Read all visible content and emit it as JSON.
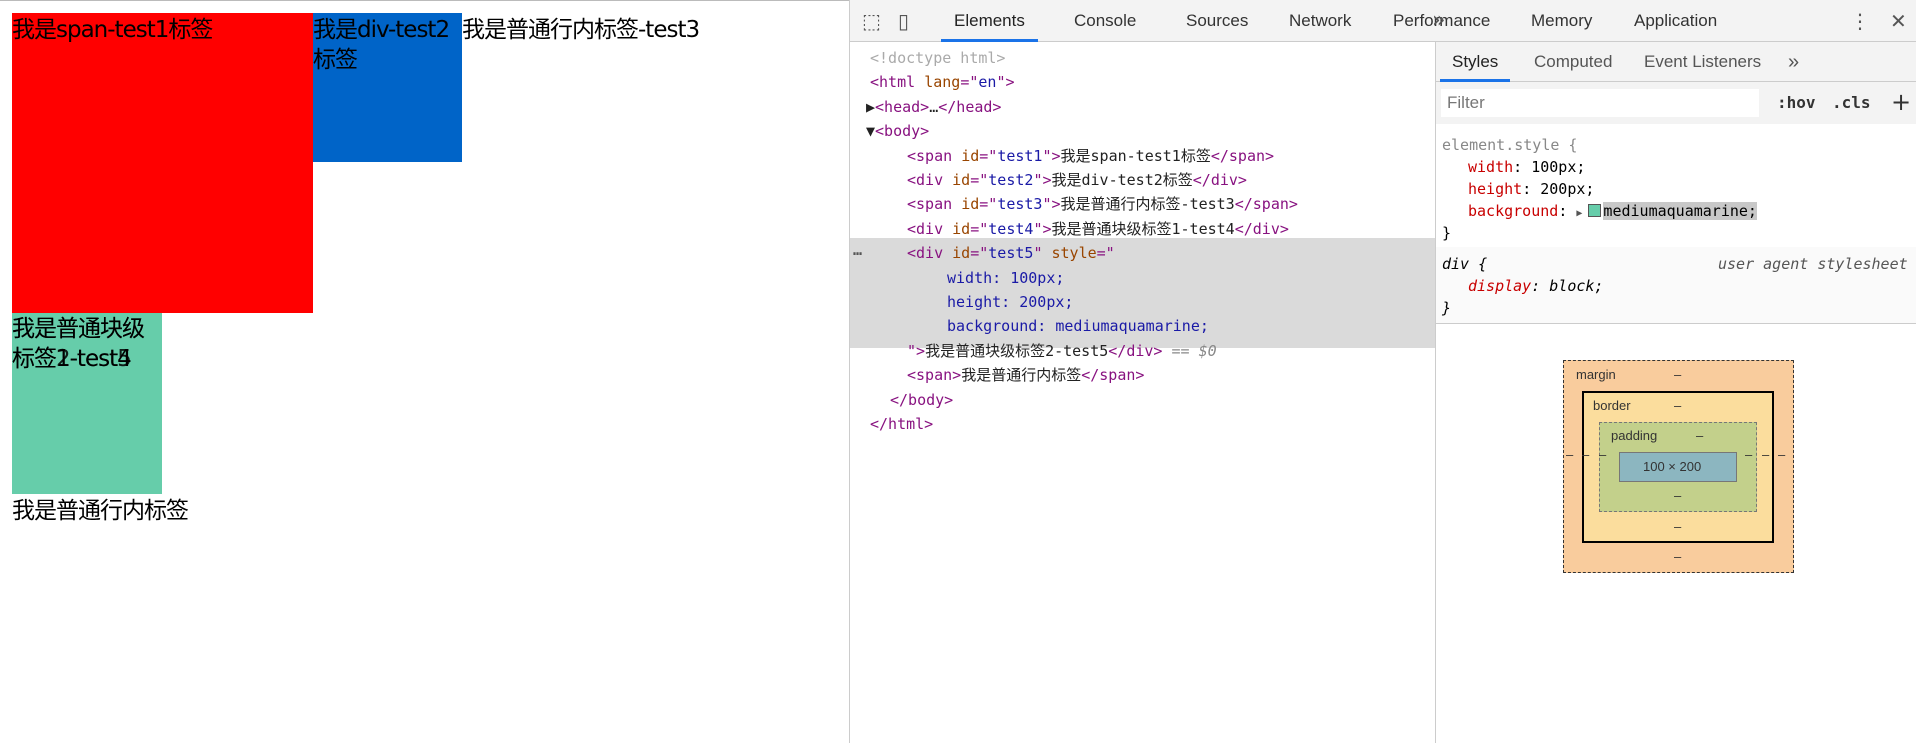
{
  "page": {
    "test1": "我是span-test1标签",
    "test2": "我是div-test2标签",
    "test3": "我是普通行内标签-test3",
    "test4": "我是普通块级标签1-test4",
    "test5": "我是普通块级标签2-test5",
    "span": "我是普通行内标签",
    "colors": {
      "test1": "#ff0000",
      "test2": "#0064c8",
      "test5": "#66cdaa"
    }
  },
  "devtools": {
    "tabs": [
      "Elements",
      "Console",
      "Sources",
      "Network",
      "Performance",
      "Memory",
      "Application"
    ],
    "active_tab": "Elements",
    "more": "»",
    "menu": "⋮",
    "close": "✕",
    "dom_lines": [
      [
        [
          "grey",
          "<!doctype html>"
        ]
      ],
      [
        [
          "tag",
          "<html "
        ],
        [
          "attr",
          "lang"
        ],
        [
          "tag",
          "=\""
        ],
        [
          "val",
          "en"
        ],
        [
          "tag",
          "\">"
        ]
      ],
      [
        [
          "txt",
          "▶"
        ],
        [
          "tag",
          "<head>"
        ],
        [
          "txt",
          "…"
        ],
        [
          "tag",
          "</head>"
        ]
      ],
      [
        [
          "txt",
          "▼"
        ],
        [
          "tag",
          "<body>"
        ]
      ],
      [
        [
          "tag",
          "<span "
        ],
        [
          "attr",
          "id"
        ],
        [
          "tag",
          "=\""
        ],
        [
          "val",
          "test1"
        ],
        [
          "tag",
          "\">"
        ],
        [
          "txt",
          "我是span-test1标签"
        ],
        [
          "tag",
          "</span>"
        ]
      ],
      [
        [
          "tag",
          "<div "
        ],
        [
          "attr",
          "id"
        ],
        [
          "tag",
          "=\""
        ],
        [
          "val",
          "test2"
        ],
        [
          "tag",
          "\">"
        ],
        [
          "txt",
          "我是div-test2标签"
        ],
        [
          "tag",
          "</div>"
        ]
      ],
      [
        [
          "tag",
          "<span "
        ],
        [
          "attr",
          "id"
        ],
        [
          "tag",
          "=\""
        ],
        [
          "val",
          "test3"
        ],
        [
          "tag",
          "\">"
        ],
        [
          "txt",
          "我是普通行内标签-test3"
        ],
        [
          "tag",
          "</span>"
        ]
      ],
      [
        [
          "tag",
          "<div "
        ],
        [
          "attr",
          "id"
        ],
        [
          "tag",
          "=\""
        ],
        [
          "val",
          "test4"
        ],
        [
          "tag",
          "\">"
        ],
        [
          "txt",
          "我是普通块级标签1-test4"
        ],
        [
          "tag",
          "</div>"
        ]
      ],
      [
        [
          "tag",
          "<div "
        ],
        [
          "attr",
          "id"
        ],
        [
          "tag",
          "=\""
        ],
        [
          "val",
          "test5"
        ],
        [
          "tag",
          "\" "
        ],
        [
          "attr",
          "style"
        ],
        [
          "tag",
          "=\""
        ]
      ],
      [
        [
          "val",
          "width: 100px;"
        ]
      ],
      [
        [
          "val",
          "height: 200px;"
        ]
      ],
      [
        [
          "val",
          "background: mediumaquamarine;"
        ]
      ],
      [
        [
          "tag",
          "\">"
        ],
        [
          "txt",
          "我是普通块级标签2-test5"
        ],
        [
          "tag",
          "</div>"
        ],
        [
          "dim",
          " == $0"
        ]
      ],
      [
        [
          "tag",
          "<span>"
        ],
        [
          "txt",
          "我是普通行内标签"
        ],
        [
          "tag",
          "</span>"
        ]
      ],
      [
        [
          "tag",
          "</body>"
        ]
      ],
      [
        [
          "tag",
          "</html>"
        ]
      ]
    ],
    "ellipsis": "…",
    "styles": {
      "tabs": [
        "Styles",
        "Computed",
        "Event Listeners"
      ],
      "more": "»",
      "filter_placeholder": "Filter",
      "hov": ":hov",
      "cls": ".cls",
      "add": "+",
      "element_style": {
        "selector": "element.style {",
        "props": [
          [
            "width",
            "100px;"
          ],
          [
            "height",
            "200px;"
          ],
          [
            "background",
            "mediumaquamarine;"
          ]
        ],
        "close": "}",
        "swatch": "#66cdaa"
      },
      "ua_rule": {
        "selector": "div {",
        "source": "user agent stylesheet",
        "props": [
          [
            "display",
            "block;"
          ]
        ],
        "close": "}"
      }
    },
    "box_model": {
      "margin": "margin",
      "border": "border",
      "padding": "padding",
      "content": "100 × 200",
      "dash": "–"
    }
  }
}
